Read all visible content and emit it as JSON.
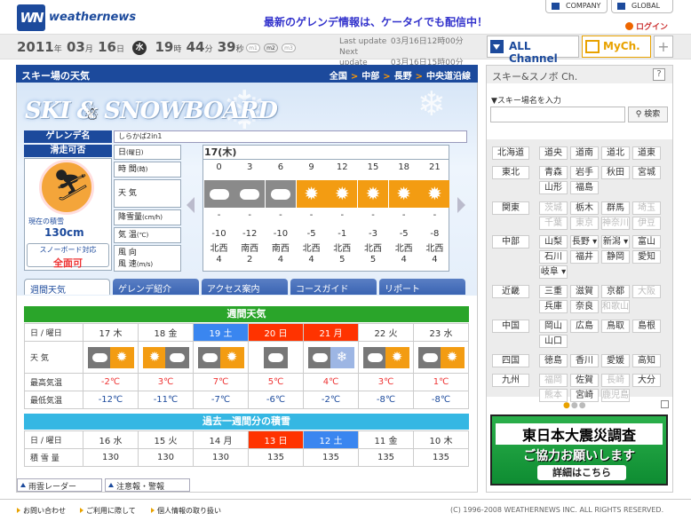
{
  "header": {
    "logo_mark": "WN",
    "brand": "weathernews",
    "promo": "最新のゲレンデ情報は、ケータイでも配信中！",
    "company": "COMPANY",
    "global": "GLOBAL",
    "login": "ログイン"
  },
  "datebar": {
    "year": "2011",
    "year_u": "年",
    "month": "03",
    "month_u": "月",
    "day": "16",
    "day_u": "日",
    "weekday": "水",
    "hour": "19",
    "hour_u": "時",
    "min": "44",
    "min_u": "分",
    "sec": "39",
    "sec_u": "秒",
    "m1": "m1",
    "m2": "m2",
    "m3": "m3",
    "last_update_lbl": "Last update",
    "last_update": "03月16日12時00分",
    "next_update_lbl": "Next update",
    "next_update": "03月16日15時00分",
    "all_channel": "ALL Channel",
    "my_ch": "MyCh.",
    "plus": "+"
  },
  "main": {
    "title": "スキー場の天気",
    "breadcrumbs": [
      "全国",
      "中部",
      "長野",
      "中央道沿線"
    ],
    "hero_title": "SKI & SNOWBOARD",
    "gelande_label": "ゲレンデ名",
    "gelande_name": "しらかば2in1",
    "kassou_label": "滑走可否",
    "snow_depth_label": "現在の積雪",
    "snow_depth": "130cm",
    "snowboard_label": "スノーボード対応",
    "snowboard_value": "全面可",
    "forecast": {
      "day": "17(木)",
      "row_labels": {
        "date": "日",
        "date_s": "(曜日)",
        "time": "時 間",
        "time_s": "(時)",
        "weather": "天 気",
        "precip": "降雪量",
        "precip_s": "(cm/h)",
        "temp": "気 温",
        "temp_s": "(℃)",
        "wind_dir": "風 向",
        "wind_spd": "風 速",
        "wind_spd_s": "(m/s)"
      },
      "hours": [
        "0",
        "3",
        "6",
        "9",
        "12",
        "15",
        "18",
        "21"
      ],
      "weather": [
        "cloudy",
        "cloudy",
        "cloudy",
        "sunny",
        "sunny",
        "sunny",
        "sunny",
        "sunny"
      ],
      "precip": [
        "-",
        "-",
        "-",
        "-",
        "-",
        "-",
        "-",
        "-"
      ],
      "temp": [
        "-10",
        "-12",
        "-10",
        "-5",
        "-1",
        "-3",
        "-5",
        "-8"
      ],
      "wind_dir": [
        "北西",
        "南西",
        "南西",
        "北西",
        "北西",
        "北西",
        "北西",
        "北西"
      ],
      "wind_spd": [
        "4",
        "2",
        "4",
        "4",
        "5",
        "5",
        "4",
        "4"
      ]
    },
    "tabs": [
      "週間天気",
      "ゲレンデ紹介",
      "アクセス案内",
      "コースガイド",
      "リポート"
    ],
    "weekly": {
      "title": "週間天気",
      "date_label": "日 / 曜日",
      "weather_label": "天 気",
      "high_label": "最高気温",
      "low_label": "最低気温",
      "days": [
        {
          "d": "17",
          "w": "木",
          "type": "",
          "icons": [
            "cloudy",
            "sunny"
          ],
          "hi": "-2℃",
          "lo": "-12℃"
        },
        {
          "d": "18",
          "w": "金",
          "type": "",
          "icons": [
            "sunny",
            "cloudy"
          ],
          "hi": "3℃",
          "lo": "-11℃"
        },
        {
          "d": "19",
          "w": "土",
          "type": "sat",
          "icons": [
            "cloudy",
            "sunny"
          ],
          "hi": "7℃",
          "lo": "-7℃"
        },
        {
          "d": "20",
          "w": "日",
          "type": "sun",
          "icons": [
            "cloudy"
          ],
          "hi": "5℃",
          "lo": "-6℃"
        },
        {
          "d": "21",
          "w": "月",
          "type": "sun",
          "icons": [
            "cloudy",
            "snow"
          ],
          "hi": "4℃",
          "lo": "-2℃"
        },
        {
          "d": "22",
          "w": "火",
          "type": "",
          "icons": [
            "cloudy",
            "sunny"
          ],
          "hi": "3℃",
          "lo": "-8℃"
        },
        {
          "d": "23",
          "w": "水",
          "type": "",
          "icons": [
            "cloudy",
            "sunny"
          ],
          "hi": "1℃",
          "lo": "-8℃"
        }
      ]
    },
    "past": {
      "title": "過去一週間分の積雪",
      "date_label": "日 / 曜日",
      "snow_label": "積 雪 量",
      "days": [
        {
          "d": "16",
          "w": "水",
          "type": "",
          "v": "130"
        },
        {
          "d": "15",
          "w": "火",
          "type": "",
          "v": "130"
        },
        {
          "d": "14",
          "w": "月",
          "type": "",
          "v": "130"
        },
        {
          "d": "13",
          "w": "日",
          "type": "sun",
          "v": "135"
        },
        {
          "d": "12",
          "w": "土",
          "type": "sat",
          "v": "135"
        },
        {
          "d": "11",
          "w": "金",
          "type": "",
          "v": "135"
        },
        {
          "d": "10",
          "w": "木",
          "type": "",
          "v": "135"
        }
      ]
    },
    "bottom_links": [
      "雨雲レーダー",
      "注意報・警報"
    ]
  },
  "sidebar": {
    "title": "スキー&スノボ Ch.",
    "help": "?",
    "search_label": "▼スキー場名を入力",
    "search_button": "検索",
    "regions": [
      {
        "name": "北海道",
        "prefs": [
          {
            "n": "道央"
          },
          {
            "n": "道南"
          },
          {
            "n": "道北"
          },
          {
            "n": "道東"
          }
        ]
      },
      {
        "name": "東北",
        "prefs": [
          {
            "n": "青森"
          },
          {
            "n": "岩手"
          },
          {
            "n": "秋田"
          },
          {
            "n": "宮城"
          },
          {
            "n": "山形"
          },
          {
            "n": "福島"
          }
        ]
      },
      {
        "name": "関東",
        "prefs": [
          {
            "n": "茨城",
            "dis": true
          },
          {
            "n": "栃木"
          },
          {
            "n": "群馬"
          },
          {
            "n": "埼玉",
            "dis": true
          },
          {
            "n": "千葉",
            "dis": true
          },
          {
            "n": "東京",
            "dis": true
          },
          {
            "n": "神奈川",
            "dis": true
          },
          {
            "n": "伊豆",
            "dis": true
          }
        ]
      },
      {
        "name": "中部",
        "prefs": [
          {
            "n": "山梨"
          },
          {
            "n": "長野 ▾"
          },
          {
            "n": "新潟 ▾"
          },
          {
            "n": "富山"
          },
          {
            "n": "石川"
          },
          {
            "n": "福井"
          },
          {
            "n": "静岡"
          },
          {
            "n": "愛知"
          },
          {
            "n": "岐阜 ▾"
          }
        ]
      },
      {
        "name": "近畿",
        "prefs": [
          {
            "n": "三重"
          },
          {
            "n": "滋賀"
          },
          {
            "n": "京都"
          },
          {
            "n": "大阪",
            "dis": true
          },
          {
            "n": "兵庫"
          },
          {
            "n": "奈良"
          },
          {
            "n": "和歌山",
            "dis": true
          }
        ]
      },
      {
        "name": "中国",
        "prefs": [
          {
            "n": "岡山"
          },
          {
            "n": "広島"
          },
          {
            "n": "鳥取"
          },
          {
            "n": "島根"
          },
          {
            "n": "山口"
          }
        ]
      },
      {
        "name": "四国",
        "prefs": [
          {
            "n": "徳島"
          },
          {
            "n": "香川"
          },
          {
            "n": "愛媛"
          },
          {
            "n": "高知"
          }
        ]
      },
      {
        "name": "九州",
        "prefs": [
          {
            "n": "福岡",
            "dis": true
          },
          {
            "n": "佐賀"
          },
          {
            "n": "長崎",
            "dis": true
          },
          {
            "n": "大分"
          },
          {
            "n": "熊本",
            "dis": true
          },
          {
            "n": "宮崎"
          },
          {
            "n": "鹿児島",
            "dis": true
          }
        ]
      }
    ],
    "banner": {
      "line1": "東日本大震災調査",
      "line2": "ご協力お願いします",
      "button": "詳細はこちら"
    }
  },
  "footer": {
    "links": [
      "お問い合わせ",
      "ご利用に際して",
      "個人情報の取り扱い"
    ],
    "copyright": "(C) 1996-2008 WEATHERNEWS INC. ALL RIGHTS RESERVED."
  }
}
